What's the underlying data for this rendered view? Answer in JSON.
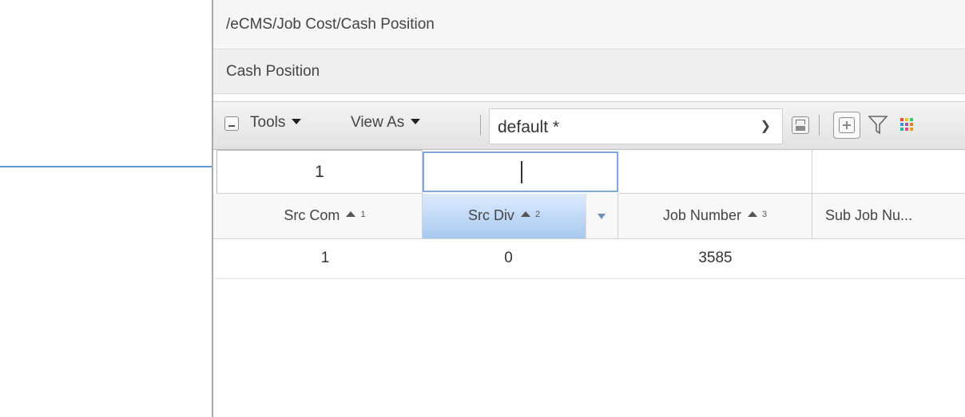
{
  "breadcrumb": "/eCMS/Job Cost/Cash Position",
  "panel_title": "Cash Position",
  "toolbar": {
    "tools_label": "Tools",
    "view_as_label": "View As",
    "view_select_value": "default *"
  },
  "filter_row": {
    "row_number": "1"
  },
  "columns": [
    {
      "label": "Src Com",
      "sort_index": "1"
    },
    {
      "label": "Src Div",
      "sort_index": "2"
    },
    {
      "label": "Job Number",
      "sort_index": "3"
    },
    {
      "label": "Sub Job Nu..."
    }
  ],
  "rows": [
    {
      "src_com": "1",
      "src_div": "0",
      "job_number": "3585",
      "sub_job": ""
    }
  ],
  "colors": {
    "annotation_arrow": "#5b9bd5",
    "active_header": "#a8c9f0"
  }
}
